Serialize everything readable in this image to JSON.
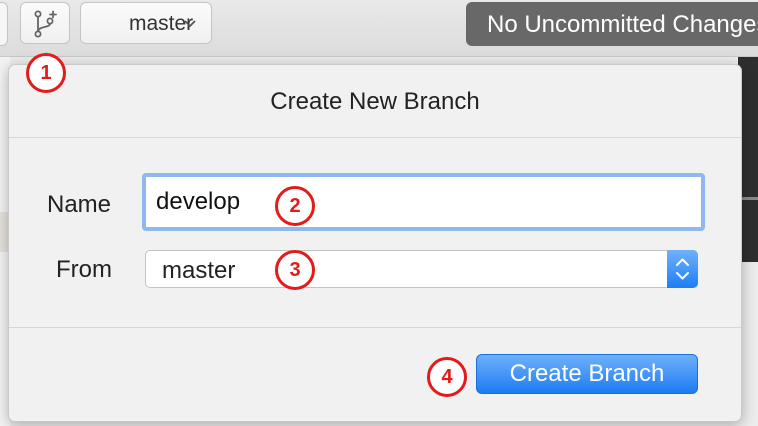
{
  "toolbar": {
    "branch_button_icon": "git-branch-add-icon",
    "branch_selector": {
      "label": "master",
      "icon": "chevron-down-icon"
    },
    "status": "No Uncommitted Changes"
  },
  "popover": {
    "title": "Create New Branch",
    "name_label": "Name",
    "name_value": "develop",
    "from_label": "From",
    "from_value": "master",
    "from_icon": "up-down-stepper-icon",
    "create_button": "Create Branch"
  },
  "annotations": [
    "1",
    "2",
    "3",
    "4"
  ],
  "colors": {
    "accent": "#1d7cf2",
    "focus_ring": "#8fb8ec",
    "annotation": "#e21b1b",
    "status_pill": "#686868"
  }
}
